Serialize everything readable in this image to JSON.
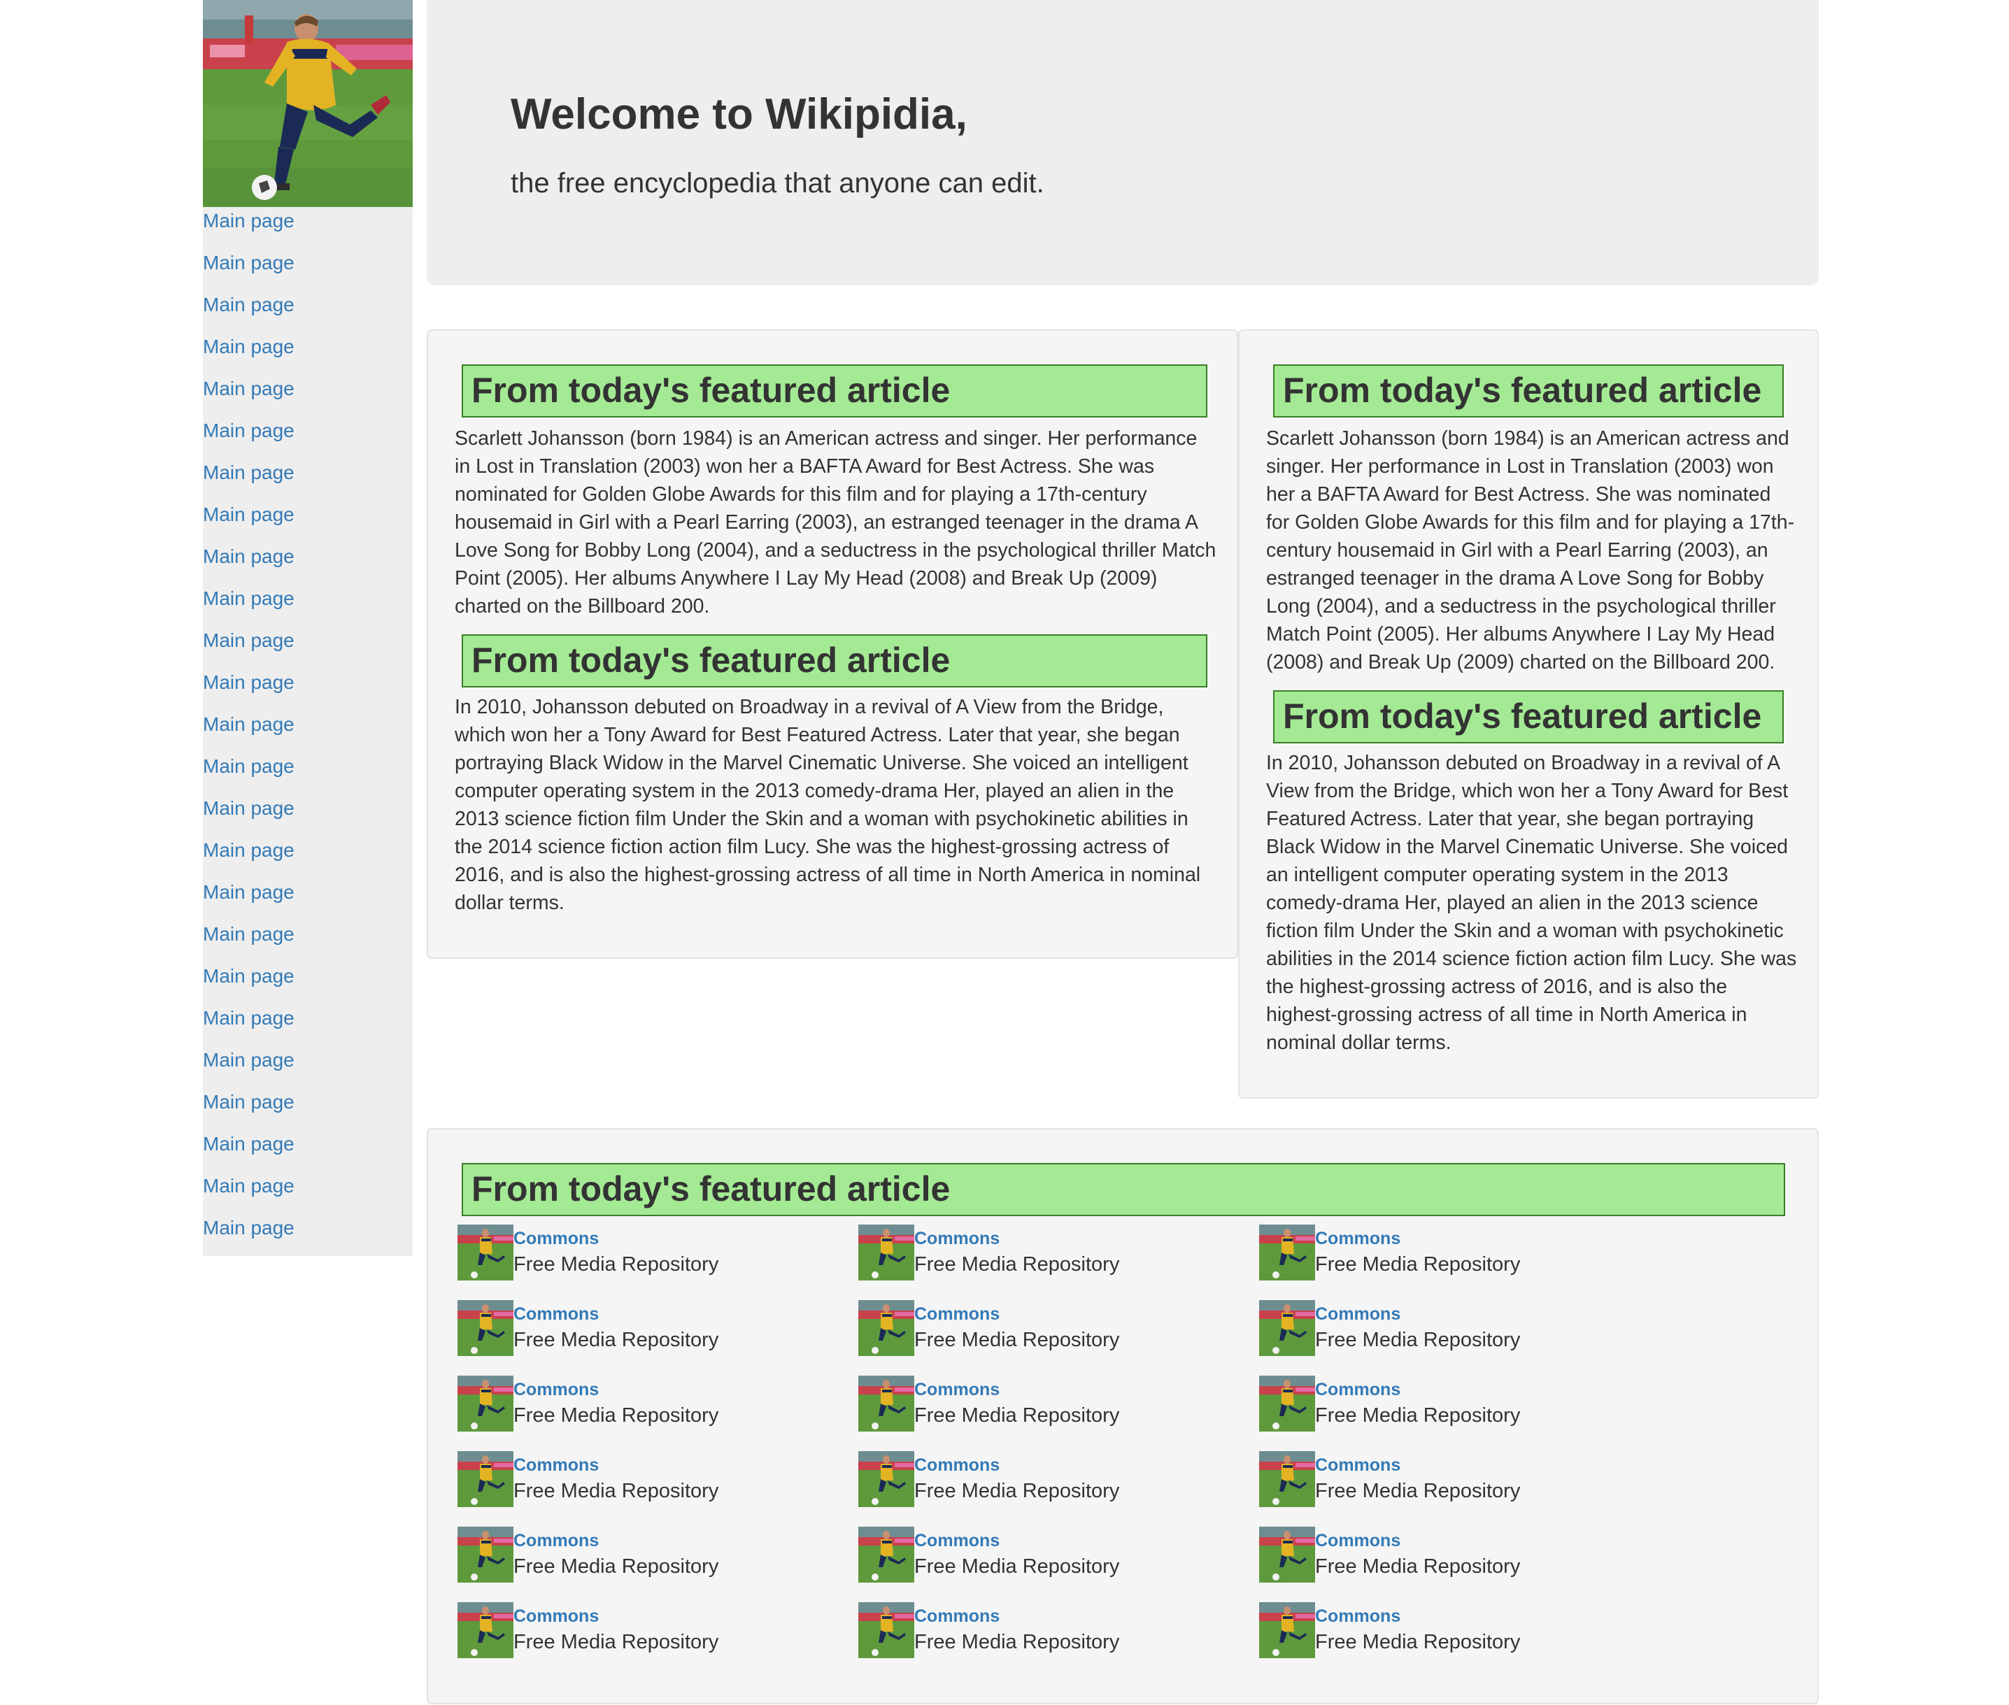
{
  "sidebar": {
    "logo": "soccer-player-photo",
    "nav_items": [
      {
        "label": "Main page"
      },
      {
        "label": "Main page"
      },
      {
        "label": "Main page"
      },
      {
        "label": "Main page"
      },
      {
        "label": "Main page"
      },
      {
        "label": "Main page"
      },
      {
        "label": "Main page"
      },
      {
        "label": "Main page"
      },
      {
        "label": "Main page"
      },
      {
        "label": "Main page"
      },
      {
        "label": "Main page"
      },
      {
        "label": "Main page"
      },
      {
        "label": "Main page"
      },
      {
        "label": "Main page"
      },
      {
        "label": "Main page"
      },
      {
        "label": "Main page"
      },
      {
        "label": "Main page"
      },
      {
        "label": "Main page"
      },
      {
        "label": "Main page"
      },
      {
        "label": "Main page"
      },
      {
        "label": "Main page"
      },
      {
        "label": "Main page"
      },
      {
        "label": "Main page"
      },
      {
        "label": "Main page"
      },
      {
        "label": "Main page"
      }
    ]
  },
  "jumbotron": {
    "title": "Welcome to Wikipidia,",
    "subtitle": "the free encyclopedia that anyone can edit."
  },
  "left_panel": {
    "heading1": "From today's featured article",
    "text1": "Scarlett Johansson (born 1984) is an American actress and singer. Her performance in Lost in Translation (2003) won her a BAFTA Award for Best Actress. She was nominated for Golden Globe Awards for this film and for playing a 17th-century housemaid in Girl with a Pearl Earring (2003), an estranged teenager in the drama A Love Song for Bobby Long (2004), and a seductress in the psychological thriller Match Point (2005). Her albums Anywhere I Lay My Head (2008) and Break Up (2009) charted on the Billboard 200.",
    "heading2": "From today's featured article",
    "text2": "In 2010, Johansson debuted on Broadway in a revival of A View from the Bridge, which won her a Tony Award for Best Featured Actress. Later that year, she began portraying Black Widow in the Marvel Cinematic Universe. She voiced an intelligent computer operating system in the 2013 comedy-drama Her, played an alien in the 2013 science fiction film Under the Skin and a woman with psychokinetic abilities in the 2014 science fiction action film Lucy. She was the highest-grossing actress of 2016, and is also the highest-grossing actress of all time in North America in nominal dollar terms."
  },
  "right_panel": {
    "heading1": "From today's featured article",
    "text1": "Scarlett Johansson (born 1984) is an American actress and singer. Her performance in Lost in Translation (2003) won her a BAFTA Award for Best Actress. She was nominated for Golden Globe Awards for this film and for playing a 17th-century housemaid in Girl with a Pearl Earring (2003), an estranged teenager in the drama A Love Song for Bobby Long (2004), and a seductress in the psychological thriller Match Point (2005). Her albums Anywhere I Lay My Head (2008) and Break Up (2009) charted on the Billboard 200.",
    "heading2": "From today's featured article",
    "text2": "In 2010, Johansson debuted on Broadway in a revival of A View from the Bridge, which won her a Tony Award for Best Featured Actress. Later that year, she began portraying Black Widow in the Marvel Cinematic Universe. She voiced an intelligent computer operating system in the 2013 comedy-drama Her, played an alien in the 2013 science fiction film Under the Skin and a woman with psychokinetic abilities in the 2014 science fiction action film Lucy. She was the highest-grossing actress of 2016, and is also the highest-grossing actress of all time in North America in nominal dollar terms."
  },
  "bottom_panel": {
    "heading": "From today's featured article",
    "tiles": [
      {
        "link": "Commons",
        "desc": "Free Media Repository"
      },
      {
        "link": "Commons",
        "desc": "Free Media Repository"
      },
      {
        "link": "Commons",
        "desc": "Free Media Repository"
      },
      {
        "link": "Commons",
        "desc": "Free Media Repository"
      },
      {
        "link": "Commons",
        "desc": "Free Media Repository"
      },
      {
        "link": "Commons",
        "desc": "Free Media Repository"
      },
      {
        "link": "Commons",
        "desc": "Free Media Repository"
      },
      {
        "link": "Commons",
        "desc": "Free Media Repository"
      },
      {
        "link": "Commons",
        "desc": "Free Media Repository"
      },
      {
        "link": "Commons",
        "desc": "Free Media Repository"
      },
      {
        "link": "Commons",
        "desc": "Free Media Repository"
      },
      {
        "link": "Commons",
        "desc": "Free Media Repository"
      },
      {
        "link": "Commons",
        "desc": "Free Media Repository"
      },
      {
        "link": "Commons",
        "desc": "Free Media Repository"
      },
      {
        "link": "Commons",
        "desc": "Free Media Repository"
      },
      {
        "link": "Commons",
        "desc": "Free Media Repository"
      },
      {
        "link": "Commons",
        "desc": "Free Media Repository"
      },
      {
        "link": "Commons",
        "desc": "Free Media Repository"
      }
    ]
  },
  "colors": {
    "link": "#337ab7",
    "heading_bg": "#a4ea94",
    "heading_border": "#3a7d2a",
    "panel_bg": "#f5f5f5",
    "jumbotron_bg": "#eeeeee"
  }
}
